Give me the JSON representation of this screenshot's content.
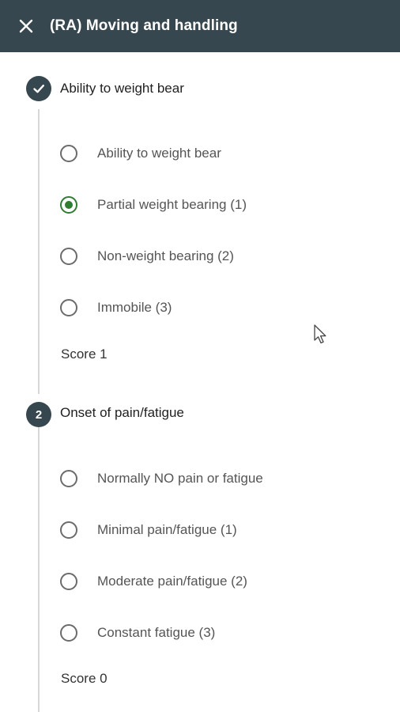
{
  "header": {
    "close_icon": "close-icon",
    "title": "(RA) Moving and handling"
  },
  "steps": [
    {
      "marker": "check-icon",
      "title": "Ability to weight bear",
      "options": [
        {
          "label": "Ability to weight bear",
          "selected": false
        },
        {
          "label": "Partial weight bearing (1)",
          "selected": true
        },
        {
          "label": "Non-weight bearing (2)",
          "selected": false
        },
        {
          "label": "Immobile (3)",
          "selected": false
        }
      ],
      "score": "Score 1"
    },
    {
      "marker": "2",
      "title": "Onset of pain/fatigue",
      "options": [
        {
          "label": "Normally NO pain or fatigue",
          "selected": false
        },
        {
          "label": "Minimal pain/fatigue (1)",
          "selected": false
        },
        {
          "label": "Moderate pain/fatigue (2)",
          "selected": false
        },
        {
          "label": "Constant fatigue (3)",
          "selected": false
        }
      ],
      "score": "Score 0"
    }
  ],
  "colors": {
    "header_bg": "#37474f",
    "selected": "#2e7d32",
    "step_line": "#d7d7d7"
  }
}
